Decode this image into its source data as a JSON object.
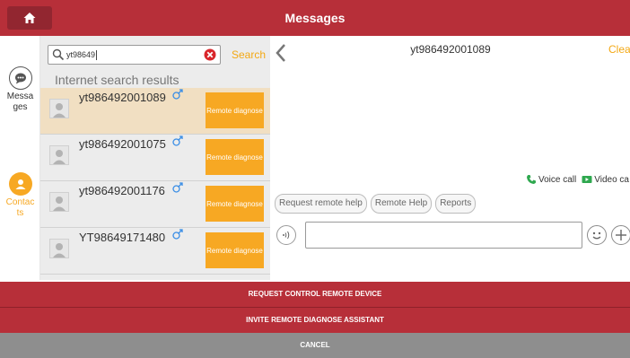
{
  "header": {
    "title": "Messages",
    "home_icon": "home-icon",
    "bg_color": "#b72f39"
  },
  "rail": {
    "items": [
      {
        "label": "Messages",
        "icon": "chat-bubble-icon"
      },
      {
        "label": "Contacts",
        "icon": "contact-person-icon",
        "color": "#f7a823"
      }
    ]
  },
  "search": {
    "value": "yt98649",
    "button_label": "Search",
    "results_label": "Internet search results"
  },
  "results": [
    {
      "name": "yt986492001089",
      "gender_icon": "male-icon",
      "action": "Remote diagnose",
      "selected": true
    },
    {
      "name": "yt986492001075",
      "gender_icon": "male-icon",
      "action": "Remote diagnose",
      "selected": false
    },
    {
      "name": "yt986492001176",
      "gender_icon": "male-icon",
      "action": "Remote diagnose",
      "selected": false
    },
    {
      "name": "YT98649171480",
      "gender_icon": "male-icon",
      "action": "Remote diagnose",
      "selected": false
    }
  ],
  "chat": {
    "peer": "yt986492001089",
    "clear_label": "Clea",
    "voice_call": "Voice call",
    "video_call": "Video ca",
    "chips": [
      "Request remote help",
      "Remote Help",
      "Reports"
    ]
  },
  "actions": {
    "request_control": "REQUEST CONTROL REMOTE DEVICE",
    "invite_assistant": "INVITE REMOTE DIAGNOSE ASSISTANT",
    "cancel": "CANCEL"
  },
  "colors": {
    "accent_orange": "#f7a823",
    "selected_row": "#f1dfc2",
    "link_orange": "#f3a814"
  }
}
